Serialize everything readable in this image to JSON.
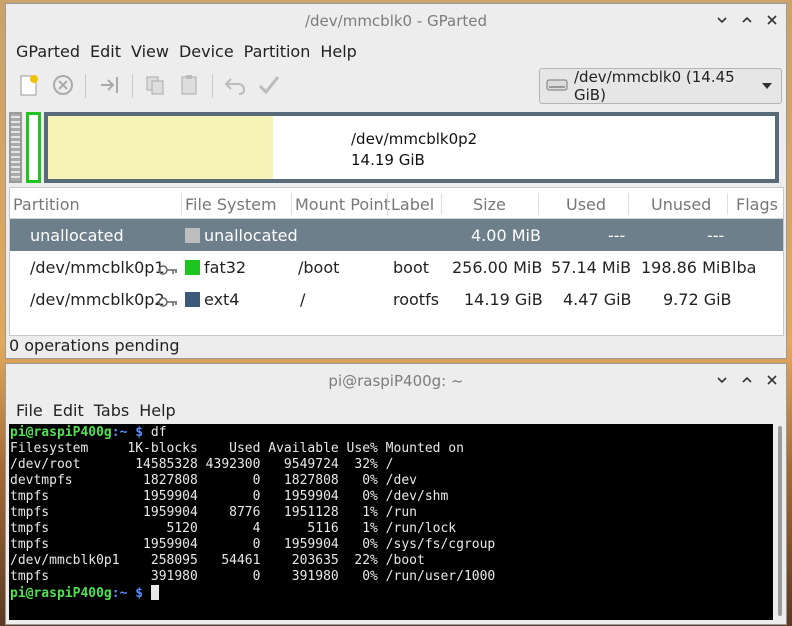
{
  "gparted": {
    "title": "/dev/mmcblk0 - GParted",
    "menu": [
      "GParted",
      "Edit",
      "View",
      "Device",
      "Partition",
      "Help"
    ],
    "device_selector": "/dev/mmcblk0  (14.45 GiB)",
    "diskmap": {
      "selected_name": "/dev/mmcblk0p2",
      "selected_size": "14.19 GiB",
      "used_fraction": 0.31
    },
    "columns": [
      "Partition",
      "File System",
      "Mount Point",
      "Label",
      "Size",
      "Used",
      "Unused",
      "Flags"
    ],
    "rows": [
      {
        "partition": "unallocated",
        "fs": "unallocated",
        "fs_color": "#bdbdbd",
        "mount": "",
        "label": "",
        "size": "4.00 MiB",
        "used": "---",
        "unused": "---",
        "flags": ""
      },
      {
        "partition": "/dev/mmcblk0p1",
        "fs": "fat32",
        "fs_color": "#1ec51e",
        "mount": "/boot",
        "label": "boot",
        "size": "256.00 MiB",
        "used": "57.14 MiB",
        "unused": "198.86 MiB",
        "flags": "lba"
      },
      {
        "partition": "/dev/mmcblk0p2",
        "fs": "ext4",
        "fs_color": "#3b5a7a",
        "mount": "/",
        "label": "rootfs",
        "size": "14.19 GiB",
        "used": "4.47 GiB",
        "unused": "9.72 GiB",
        "flags": ""
      }
    ],
    "status": "0 operations pending"
  },
  "terminal": {
    "title": "pi@raspiP400g: ~",
    "menu": [
      "File",
      "Edit",
      "Tabs",
      "Help"
    ],
    "prompt_user": "pi@raspiP400g",
    "prompt_path": ":~ $",
    "command": "df",
    "output": [
      "Filesystem     1K-blocks    Used Available Use% Mounted on",
      "/dev/root       14585328 4392300   9549724  32% /",
      "devtmpfs         1827808       0   1827808   0% /dev",
      "tmpfs            1959904       0   1959904   0% /dev/shm",
      "tmpfs            1959904    8776   1951128   1% /run",
      "tmpfs               5120       4      5116   1% /run/lock",
      "tmpfs            1959904       0   1959904   0% /sys/fs/cgroup",
      "/dev/mmcblk0p1    258095   54461    203635  22% /boot",
      "tmpfs             391980       0    391980   0% /run/user/1000"
    ]
  },
  "colors": {
    "selection": "#6e7f8c",
    "fat32": "#1ec51e",
    "ext4_border": "#566a7a",
    "used_fill": "#f7f3b6",
    "prompt_green": "#4ee24e",
    "prompt_blue": "#5c8cff"
  }
}
